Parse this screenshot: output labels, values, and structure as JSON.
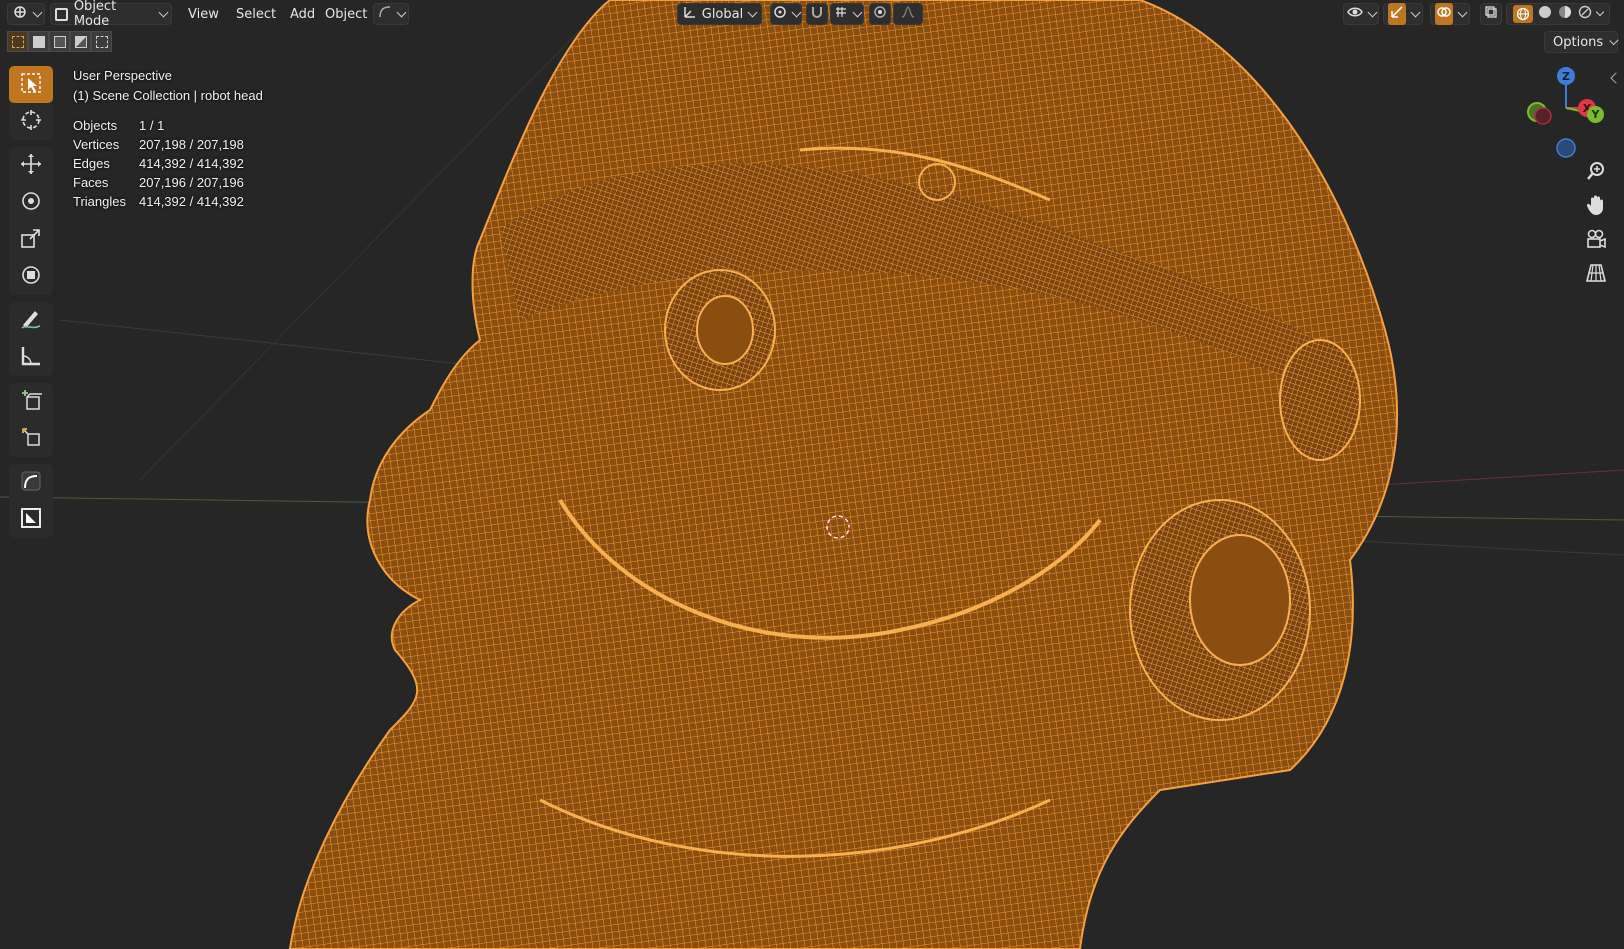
{
  "header": {
    "mode_label": "Object Mode",
    "menus": [
      "View",
      "Select",
      "Add",
      "Object"
    ],
    "transform_orientation": "Global"
  },
  "options_label": "Options",
  "overlay": {
    "view_name": "User Perspective",
    "collection": "(1) Scene Collection | robot head",
    "stats": [
      {
        "label": "Objects",
        "value": "1 / 1"
      },
      {
        "label": "Vertices",
        "value": "207,198 / 207,198"
      },
      {
        "label": "Edges",
        "value": "414,392 / 414,392"
      },
      {
        "label": "Faces",
        "value": "207,196 / 207,196"
      },
      {
        "label": "Triangles",
        "value": "414,392 / 414,392"
      }
    ]
  },
  "gizmo": {
    "x_label": "X",
    "y_label": "Y",
    "z_label": "Z"
  },
  "colors": {
    "background": "#262626",
    "wireframe": "#f0962c",
    "active_tool": "#c07520",
    "axis_x": "#e0364a",
    "axis_y": "#7bbd2a",
    "axis_z": "#3f7ed6"
  },
  "toolbar_tools": [
    "select-box",
    "cursor",
    "move",
    "rotate",
    "scale",
    "transform",
    "annotate",
    "measure",
    "add-cube",
    "extrude",
    "curve",
    "image"
  ]
}
